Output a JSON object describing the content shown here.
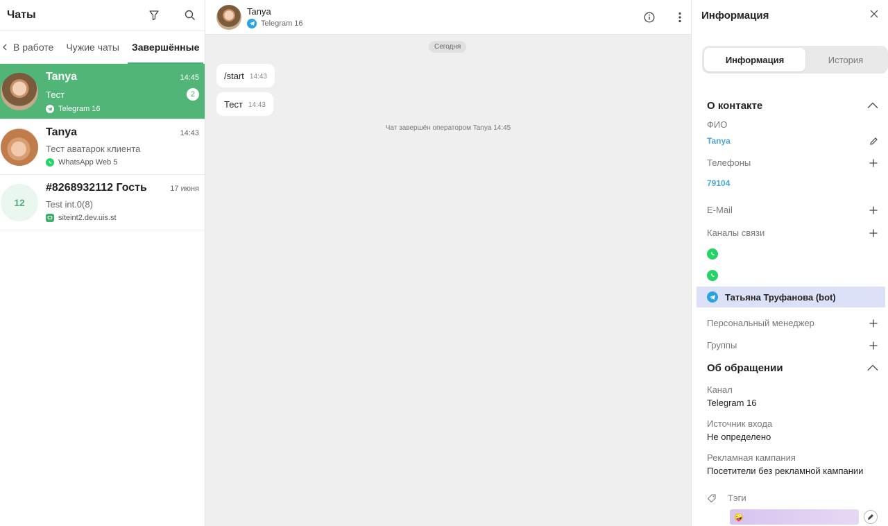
{
  "left": {
    "title": "Чаты",
    "tabs": [
      "В работе",
      "Чужие чаты",
      "Завершённые"
    ],
    "chats": [
      {
        "name": "Tanya",
        "time": "14:45",
        "preview": "Тест",
        "badge": "2",
        "channel": "Telegram 16",
        "channel_icon": "telegram-icon"
      },
      {
        "name": "Tanya",
        "time": "14:43",
        "preview": "Тест аватарок клиента",
        "channel": "WhatsApp Web 5",
        "channel_icon": "whatsapp-icon"
      },
      {
        "name": "#8268932112 Гость",
        "time": "17 июня",
        "preview": "Test int.0(8)",
        "channel": "siteint2.dev.uis.st",
        "channel_icon": "site-chat-icon",
        "avatar_text": "12"
      }
    ]
  },
  "center": {
    "contact_name": "Tanya",
    "contact_channel": "Telegram 16",
    "date_label": "Сегодня",
    "messages": [
      {
        "text": "/start",
        "time": "14:43"
      },
      {
        "text": "Тест",
        "time": "14:43"
      }
    ],
    "system_message": "Чат завершён оператором Tanya 14:45"
  },
  "right": {
    "title": "Информация",
    "seg_tabs": [
      "Информация",
      "История"
    ],
    "about_contact": {
      "title": "О контакте",
      "fio_label": "ФИО",
      "fio_value": "Tanya",
      "phones_label": "Телефоны",
      "phone_value": "79104",
      "email_label": "E-Mail",
      "channels_label": "Каналы связи",
      "channels": [
        {
          "icon": "whatsapp-icon",
          "name": ""
        },
        {
          "icon": "whatsapp-icon",
          "name": ""
        },
        {
          "icon": "telegram-icon",
          "name": "Татьяна Труфанова (bot)"
        }
      ],
      "manager_label": "Персональный менеджер",
      "groups_label": "Группы"
    },
    "about_request": {
      "title": "Об обращении",
      "channel_label": "Канал",
      "channel_value": "Telegram 16",
      "source_label": "Источник входа",
      "source_value": "Не определено",
      "campaign_label": "Рекламная кампания",
      "campaign_value": "Посетители без рекламной кампании",
      "tags_label": "Тэги",
      "tag_value": "🤪"
    }
  },
  "colors": {
    "accent_green": "#52b578",
    "link_blue": "#4ba6d8",
    "telegram_blue": "#2aa3e0",
    "whatsapp_green": "#25d366",
    "selected_row": "#dde1f7"
  }
}
